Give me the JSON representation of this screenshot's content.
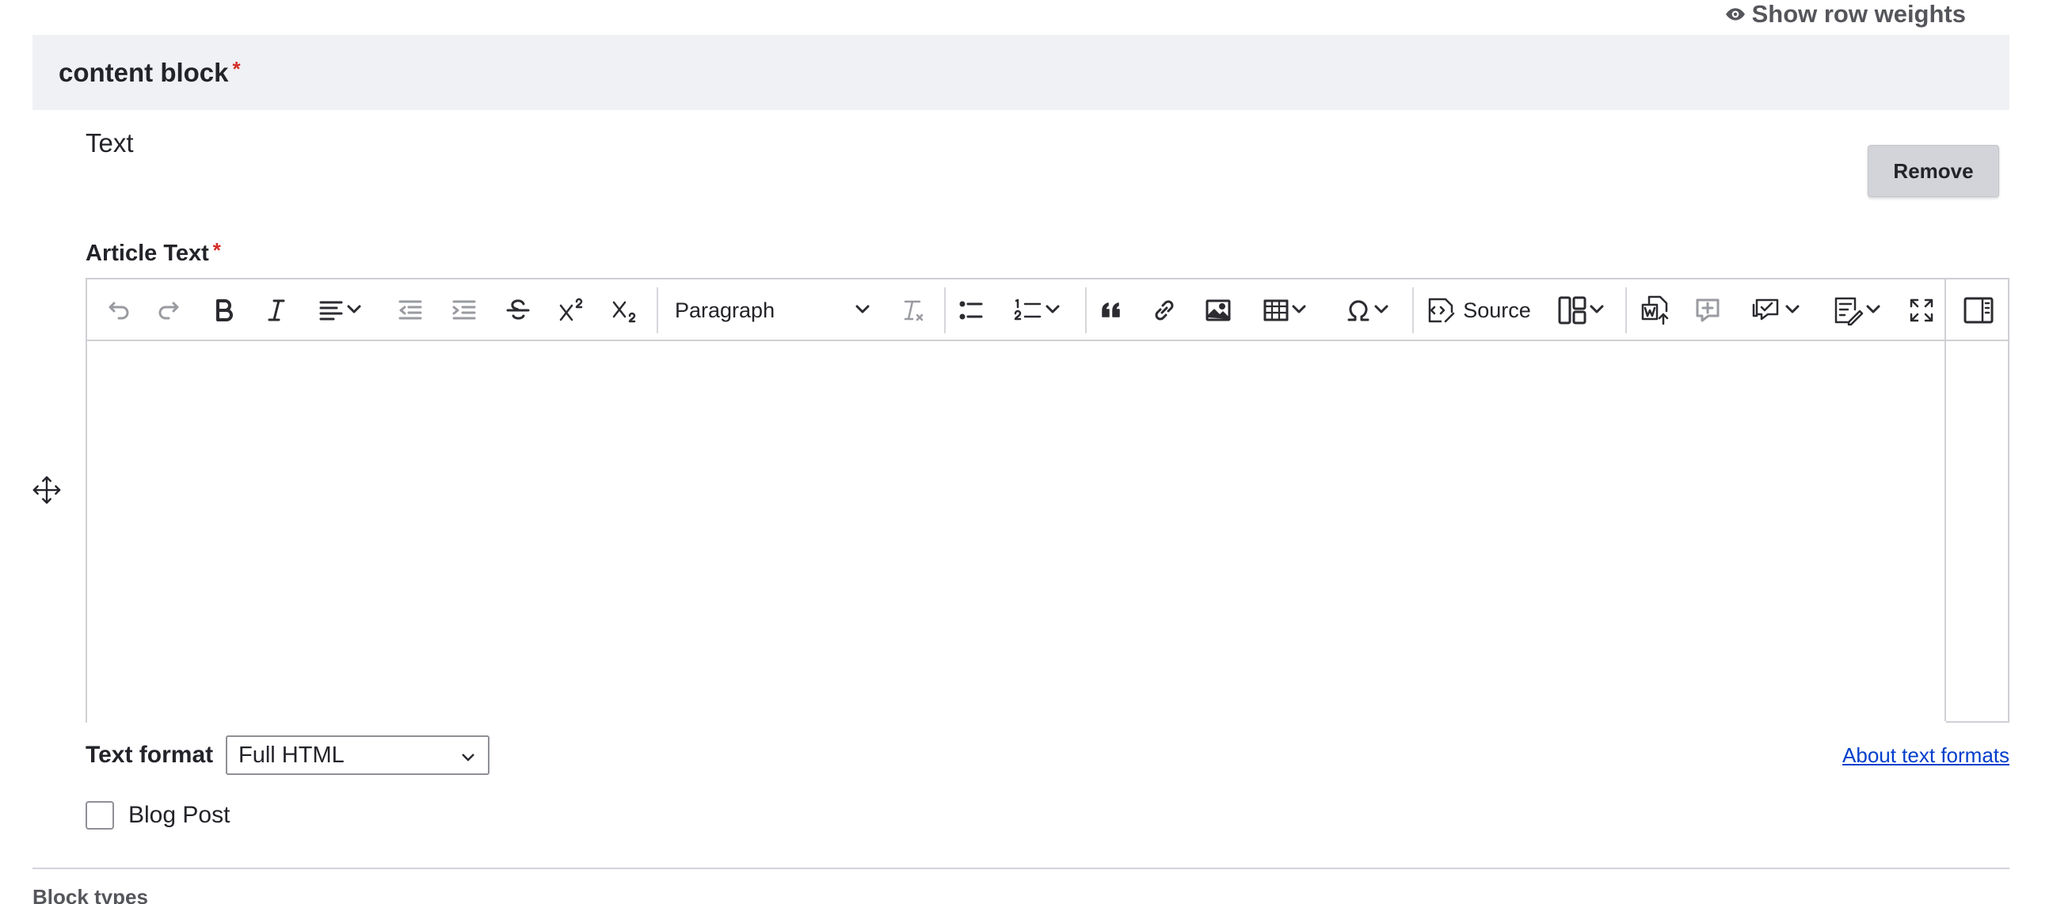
{
  "header_actions": {
    "show_row_weights": "Show row weights"
  },
  "block": {
    "title": "content block",
    "required_marker": "*",
    "type_label": "Text",
    "remove_label": "Remove"
  },
  "field": {
    "label": "Article Text",
    "required_marker": "*"
  },
  "toolbar": {
    "heading_select": "Paragraph",
    "source_label": "Source",
    "icons": [
      "undo-icon",
      "redo-icon",
      "bold-icon",
      "italic-icon",
      "align-icon",
      "outdent-icon",
      "indent-icon",
      "strikethrough-icon",
      "superscript-icon",
      "subscript-icon",
      "remove-format-icon",
      "bulleted-list-icon",
      "numbered-list-icon",
      "blockquote-icon",
      "link-icon",
      "image-icon",
      "table-icon",
      "special-characters-icon",
      "source-icon",
      "layout-icon",
      "import-word-icon",
      "add-comment-icon",
      "comments-icon",
      "track-changes-icon",
      "fullscreen-icon",
      "sidebar-toggle-icon"
    ]
  },
  "text_format": {
    "label": "Text format",
    "selected": "Full HTML",
    "about_link": "About text formats"
  },
  "checkbox": {
    "label": "Blog Post",
    "checked": false
  },
  "next_section": {
    "title": "Block types"
  }
}
